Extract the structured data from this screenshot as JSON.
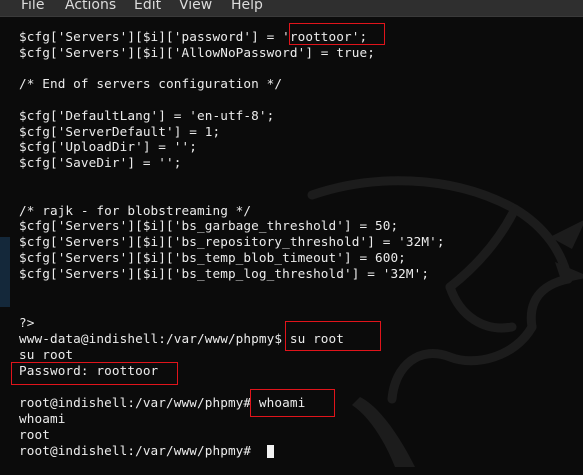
{
  "menu": {
    "items": [
      "File",
      "Actions",
      "Edit",
      "View",
      "Help"
    ]
  },
  "terminal": {
    "lines": [
      "$cfg['Servers'][$i]['password'] = 'roottoor';",
      "$cfg['Servers'][$i]['AllowNoPassword'] = true;",
      "",
      "/* End of servers configuration */",
      "",
      "$cfg['DefaultLang'] = 'en-utf-8';",
      "$cfg['ServerDefault'] = 1;",
      "$cfg['UploadDir'] = '';",
      "$cfg['SaveDir'] = '';",
      "",
      "",
      "/* rajk - for blobstreaming */",
      "$cfg['Servers'][$i]['bs_garbage_threshold'] = 50;",
      "$cfg['Servers'][$i]['bs_repository_threshold'] = '32M';",
      "$cfg['Servers'][$i]['bs_temp_blob_timeout'] = 600;",
      "$cfg['Servers'][$i]['bs_temp_log_threshold'] = '32M';",
      "",
      "",
      "?>",
      "www-data@indishell:/var/www/phpmy$ su root",
      "su root",
      "Password: roottoor",
      "",
      "root@indishell:/var/www/phpmy# whoami",
      "whoami",
      "root",
      "root@indishell:/var/www/phpmy# "
    ]
  },
  "colors": {
    "menubar": "#2f2f2f",
    "background": "#0b0b0b",
    "text": "#ececec",
    "highlight_box": "#e0141b"
  },
  "icons": {
    "background_logo": "kali-dragon-icon"
  }
}
